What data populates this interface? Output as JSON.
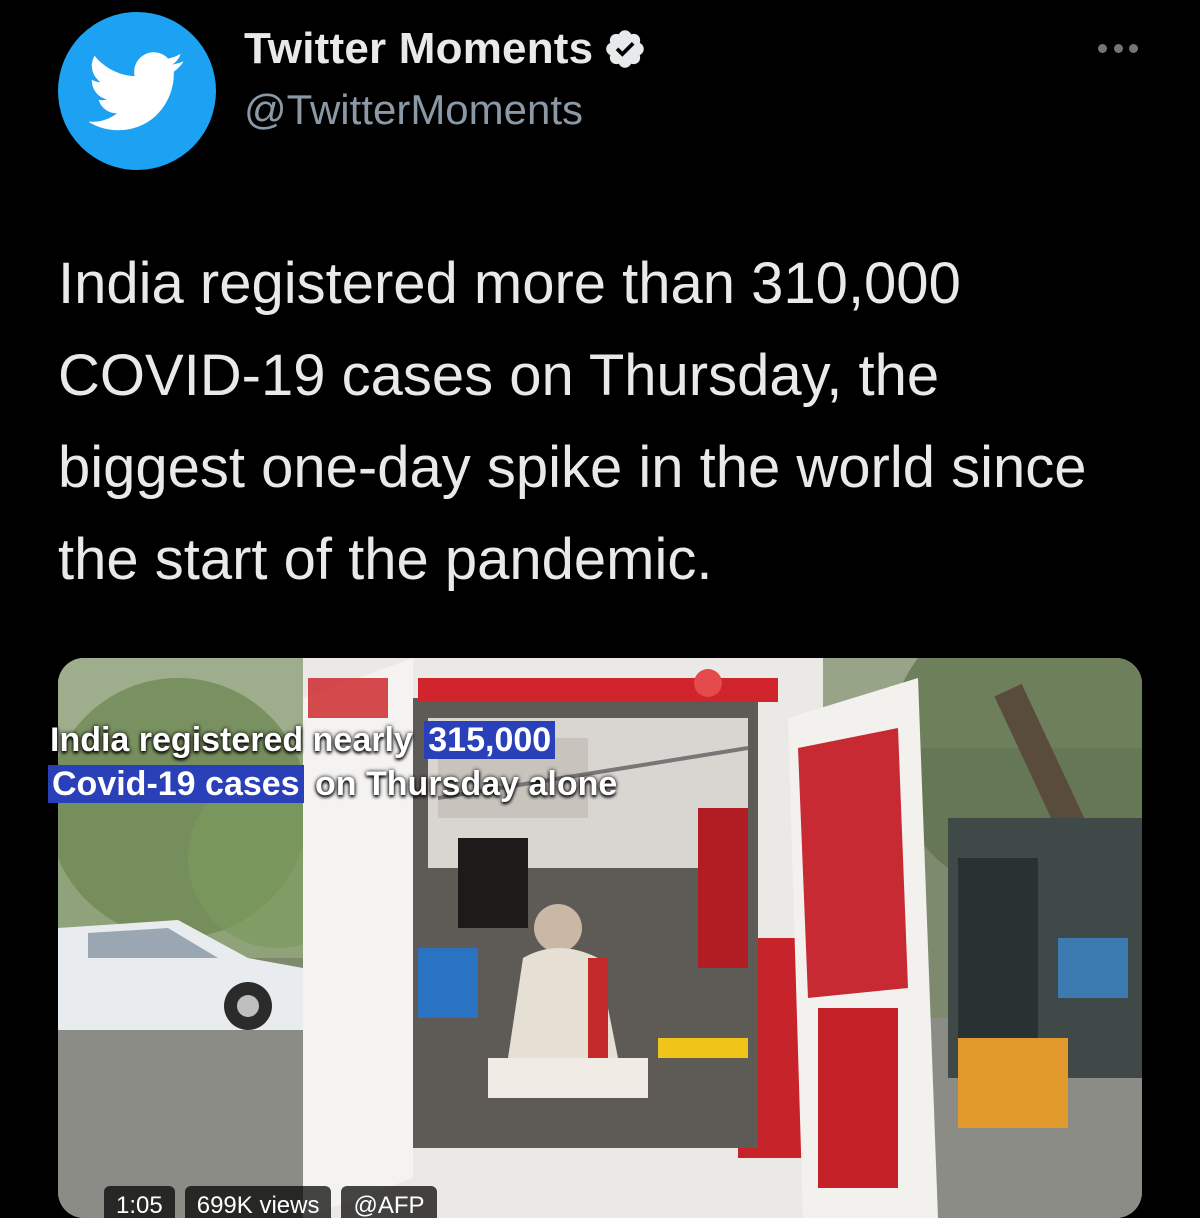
{
  "author": {
    "display_name": "Twitter Moments",
    "handle": "@TwitterMoments",
    "verified": true,
    "avatar_icon": "twitter-bird-icon",
    "brand_color": "#1da1f2"
  },
  "menu": {
    "icon": "more-horizontal-icon"
  },
  "tweet": {
    "text": "India registered more than 310,000 COVID-19 cases on Thursday, the biggest one-day spike in the world since the start of the pandemic."
  },
  "media": {
    "type": "video",
    "caption": {
      "line1_plain": "India registered nearly ",
      "line1_highlight": "315,000",
      "line2_highlight": "Covid-19 cases",
      "line2_plain": " on Thursday alone"
    },
    "meta": {
      "duration": "1:05",
      "views": "699K views",
      "source": "@AFP"
    },
    "highlight_color": "#2a40b8"
  }
}
